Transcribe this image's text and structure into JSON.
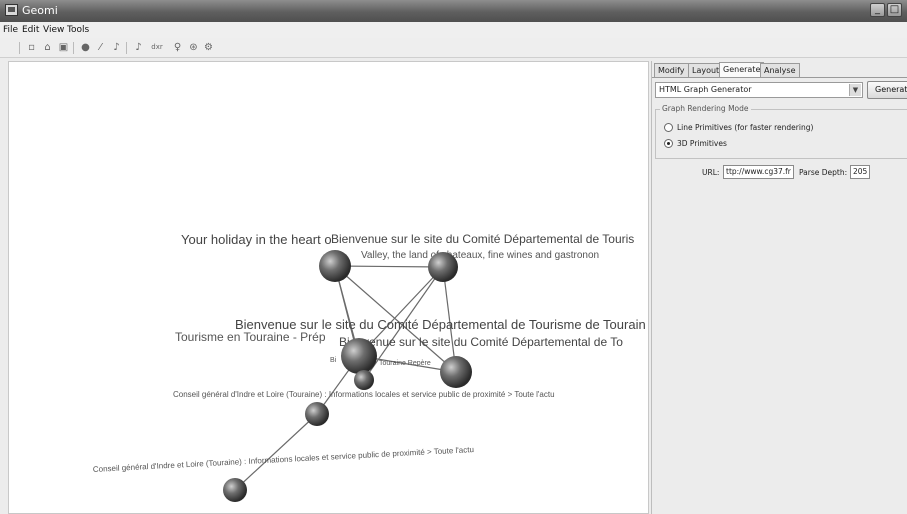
{
  "window": {
    "title": "Geomi"
  },
  "menu": {
    "file": "File",
    "edit": "Edit",
    "view": "View",
    "tools": "Tools"
  },
  "toolbar": {
    "icons": [
      "new-file-icon",
      "open-folder-icon",
      "save-icon",
      "node-icon",
      "edge-icon",
      "layout-icon",
      "graph-icon",
      "metric-icon",
      "light-icon",
      "rotate-icon",
      "settings-icon"
    ],
    "tool_label": "dxr"
  },
  "panel": {
    "tabs": [
      "Modify",
      "Layout",
      "Generate",
      "Analyse"
    ],
    "active_tab": "Generate",
    "generator": "HTML Graph Generator",
    "generate_button": "Generate",
    "group_title": "Graph Rendering Mode",
    "mode_line": "Line Primitives (for faster rendering)",
    "mode_3d": "3D Primitives",
    "selected_mode": "3D Primitives",
    "url_label": "URL:",
    "url_value": "ttp://www.cg37.fr",
    "depth_label": "Parse Depth:",
    "depth_value": "205"
  },
  "graph": {
    "labels": {
      "l1": "Your holiday in the heart o",
      "l2": "Bienvenue sur le site du Comité Départemental de Touris",
      "l3": "Valley, the land of chateaux, fine wines and gastronon",
      "l4": "Bienvenue sur le site du Comité Départemental de Tourisme de Tourain",
      "l5": "Tourisme en Touraine - Prép",
      "l6": "Bienvenue sur le site du Comité Départemental de To",
      "l7": "Bi",
      "l8": "Touraine Repère",
      "l9": "Conseil général d'Indre et Loire (Touraine) : Informations locales et service public de proximité > Toute l'actu",
      "l10": "Conseil général d'Indre et Loire (Touraine) : Informations locales et service public de proximité > Toute l'actu"
    }
  }
}
